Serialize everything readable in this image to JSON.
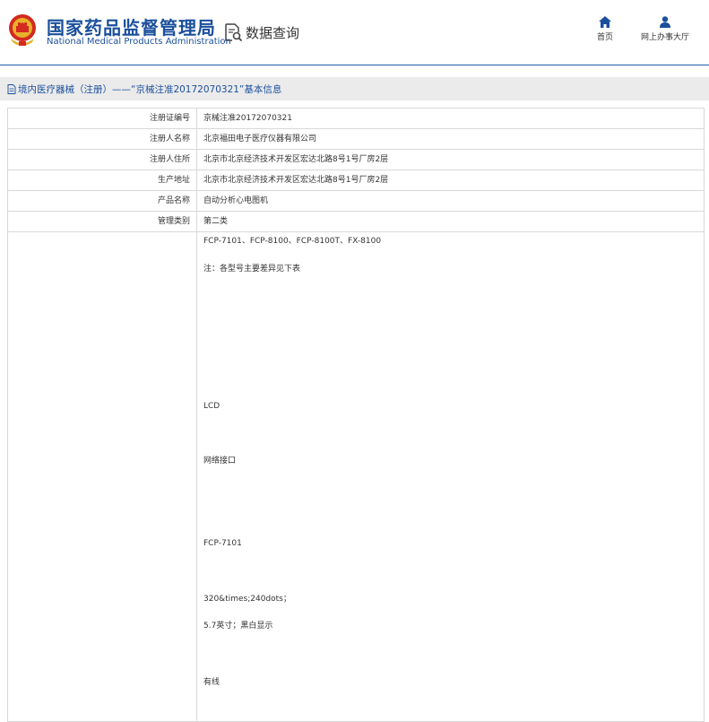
{
  "header": {
    "site_name_cn": "国家药品监督管理局",
    "site_name_en": "National Medical Products Administration",
    "data_query_label": "数据查询",
    "nav": [
      {
        "label": "首页",
        "icon": "home-icon"
      },
      {
        "label": "网上办事大厅",
        "icon": "user-icon"
      }
    ],
    "brand_color": "#1a4f9c"
  },
  "title_bar": {
    "text": "境内医疗器械（注册）——“京械注准20172070321”基本信息",
    "icon": "document-icon"
  },
  "rows": [
    {
      "label": "注册证编号",
      "value": "京械注准20172070321"
    },
    {
      "label": "注册人名称",
      "value": "北京福田电子医疗仪器有限公司"
    },
    {
      "label": "注册人住所",
      "value": "北京市北京经济技术开发区宏达北路8号1号厂房2层"
    },
    {
      "label": "生产地址",
      "value": "北京市北京经济技术开发区宏达北路8号1号厂房2层"
    },
    {
      "label": "产品名称",
      "value": "自动分析心电图机"
    },
    {
      "label": "管理类别",
      "value": "第二类"
    }
  ],
  "spec_lines": [
    "FCP-7101、FCP-8100、FCP-8100T、FX-8100",
    "注：各型号主要差异见下表",
    "LCD",
    "网络接口",
    "FCP-7101",
    "320&times;240dots；",
    "5.7英寸；黑白显示",
    "有线"
  ]
}
